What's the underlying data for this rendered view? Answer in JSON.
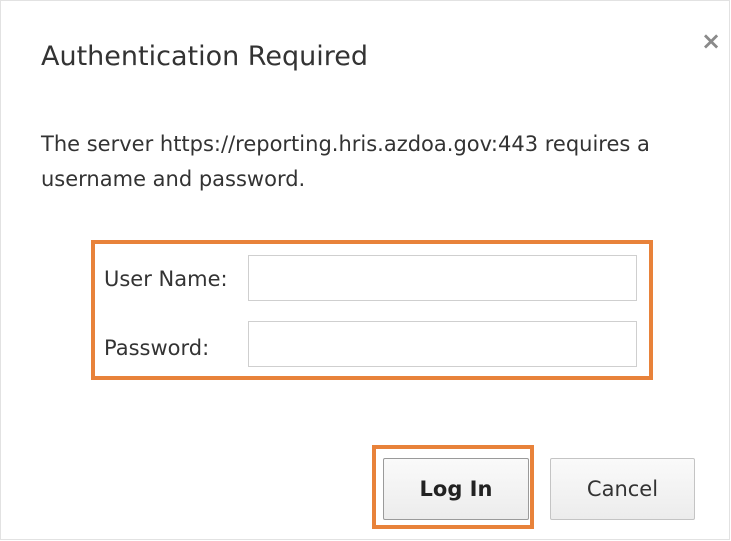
{
  "dialog": {
    "title": "Authentication Required",
    "close_glyph": "×",
    "message": "The server https://reporting.hris.azdoa.gov:443 requires a username and password."
  },
  "form": {
    "username_label": "User Name:",
    "username_value": "",
    "password_label": "Password:",
    "password_value": ""
  },
  "buttons": {
    "login_label": "Log In",
    "cancel_label": "Cancel"
  },
  "highlight_color": "#e8823a",
  "icons": [
    "close-icon"
  ]
}
